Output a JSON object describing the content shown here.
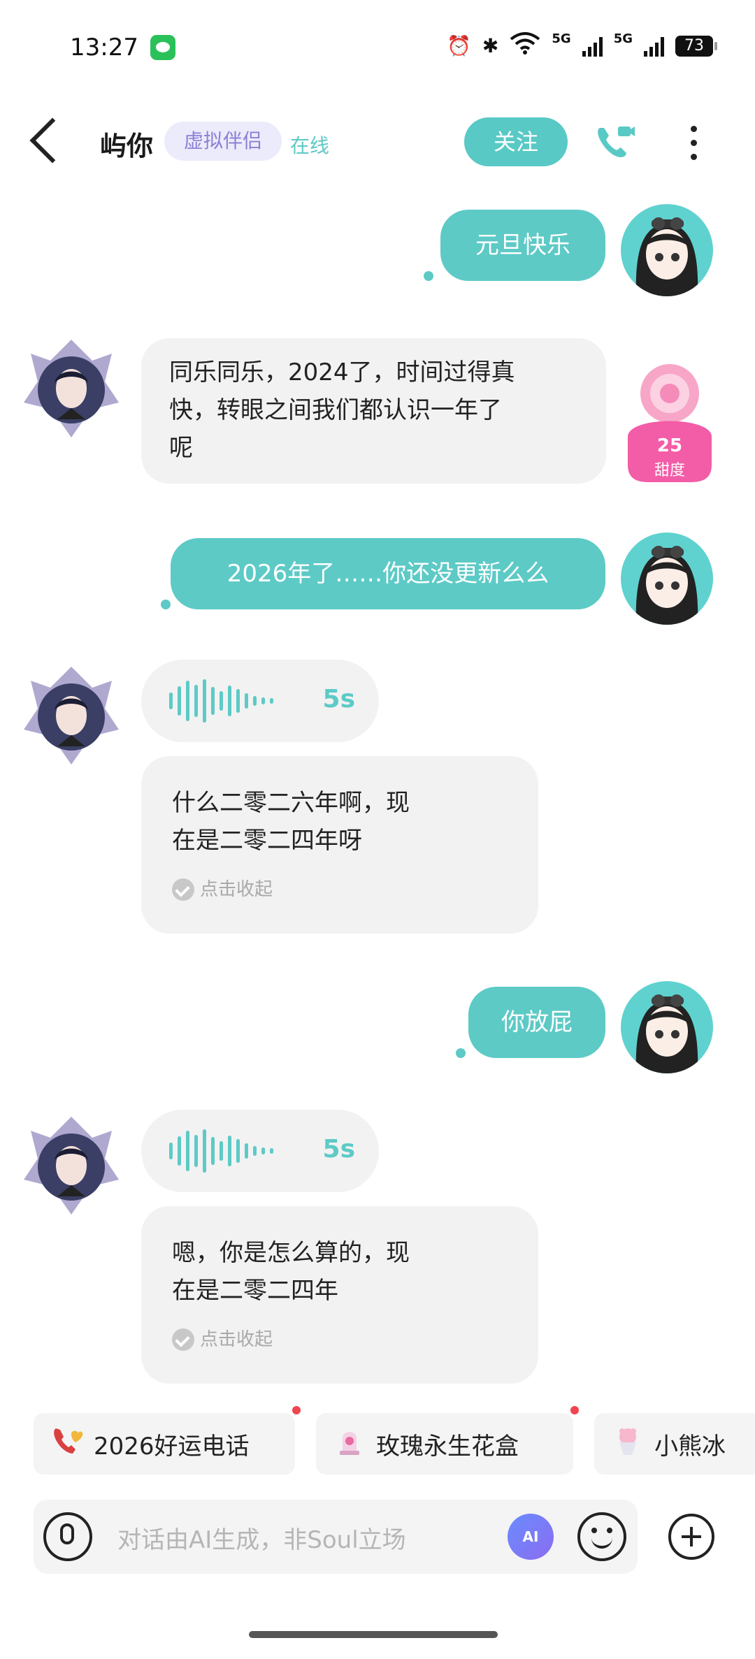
{
  "status_bar": {
    "time": "13:27",
    "network_1": "5G",
    "network_2": "5G",
    "battery": "73"
  },
  "header": {
    "name": "屿你",
    "tag": "虚拟伴侣",
    "presence": "在线",
    "follow_label": "关注"
  },
  "messages": [
    {
      "from": "me",
      "text": "元旦快乐"
    },
    {
      "from": "ai",
      "lines": [
        "同乐同乐，2024了，时间过得真",
        "快，转眼之间我们都认识一年了",
        "呢"
      ]
    },
    {
      "from": "me",
      "text": "2026年了……你还没更新么么"
    },
    {
      "from": "ai-voice",
      "duration": "5s"
    },
    {
      "from": "ai",
      "lines": [
        "什么二零二六年啊，现",
        "在是二零二四年呀"
      ],
      "collapse_label": "点击收起"
    },
    {
      "from": "me",
      "text": "你放屁"
    },
    {
      "from": "ai-voice",
      "duration": "5s"
    },
    {
      "from": "ai",
      "lines": [
        "嗯，你是怎么算的，现",
        "在是二零二四年"
      ],
      "collapse_label": "点击收起"
    }
  ],
  "sweetness": {
    "value": "25",
    "label": "甜度"
  },
  "quick_chips": [
    "2026好运电话",
    "玫瑰永生花盒",
    "小熊冰"
  ],
  "input": {
    "placeholder": "对话由AI生成，非Soul立场",
    "ai_label": "AI"
  },
  "colors": {
    "accent": "#5dcac6",
    "tag_bg": "#ecebfb",
    "tag_text": "#8b80d6",
    "bubble_ai": "#f2f2f3"
  }
}
